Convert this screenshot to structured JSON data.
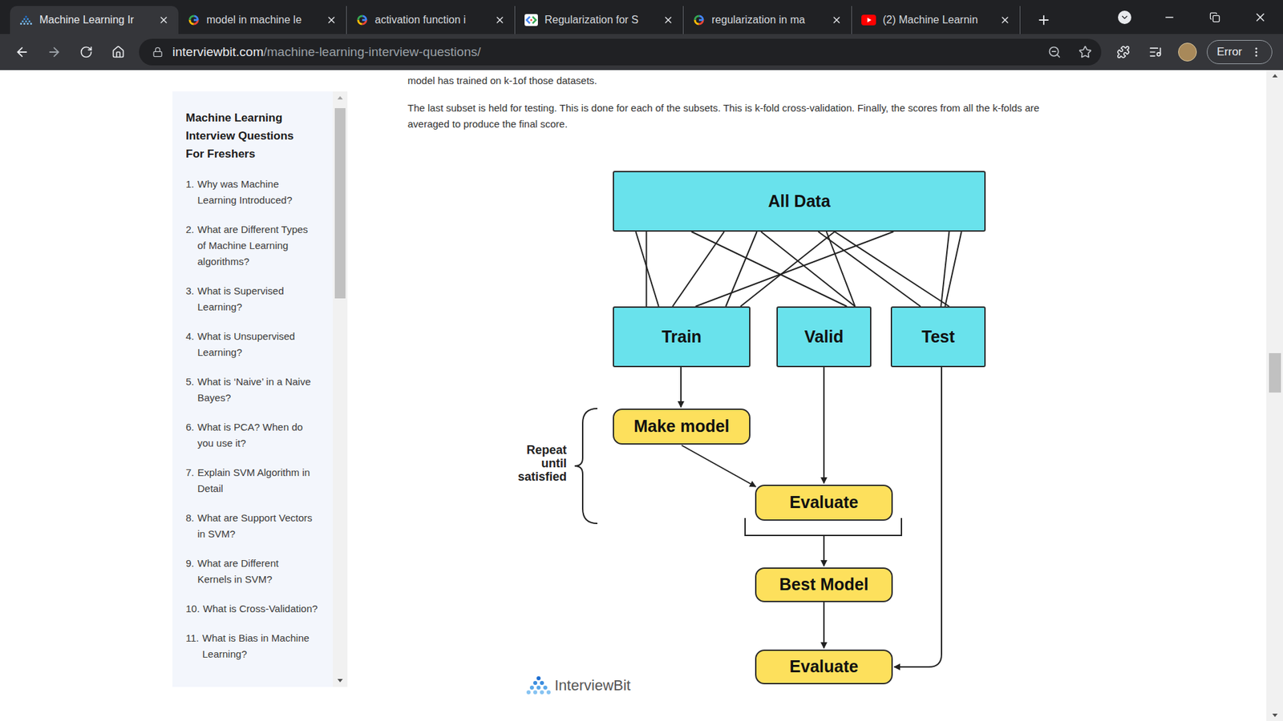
{
  "browser": {
    "tabs": [
      {
        "label": "Machine Learning Ir",
        "selected": true,
        "kind": "interviewbit"
      },
      {
        "label": "model in machine le",
        "selected": false,
        "kind": "google"
      },
      {
        "label": "activation function i",
        "selected": false,
        "kind": "google"
      },
      {
        "label": "Regularization for S",
        "selected": false,
        "kind": "developers"
      },
      {
        "label": "regularization in ma",
        "selected": false,
        "kind": "google"
      },
      {
        "label": "(2) Machine Learnin",
        "selected": false,
        "kind": "youtube"
      }
    ],
    "address": {
      "domain": "interviewbit.com",
      "path": "/machine-learning-interview-questions/"
    },
    "profile_status": "Error"
  },
  "sidebar": {
    "title": "Machine Learning Interview Questions For Freshers",
    "items": [
      {
        "number": "1.",
        "label": "Why was Machine Learning Introduced?"
      },
      {
        "number": "2.",
        "label": "What are Different Types of Machine Learning algorithms?"
      },
      {
        "number": "3.",
        "label": "What is Supervised Learning?"
      },
      {
        "number": "4.",
        "label": "What is Unsupervised Learning?"
      },
      {
        "number": "5.",
        "label": "What is ‘Naive’ in a Naive Bayes?"
      },
      {
        "number": "6.",
        "label": "What is PCA? When do you use it?"
      },
      {
        "number": "7.",
        "label": "Explain SVM Algorithm in Detail"
      },
      {
        "number": "8.",
        "label": "What are Support Vectors in SVM?"
      },
      {
        "number": "9.",
        "label": "What are Different Kernels in SVM?"
      },
      {
        "number": "10.",
        "label": "What is Cross-Validation?"
      },
      {
        "number": "11.",
        "label": "What is Bias in Machine Learning?"
      }
    ]
  },
  "article": {
    "paragraphs": [
      "model has trained on k-1of those datasets.",
      "The last subset is held for testing. This is done for each of the subsets. This is k-fold cross-validation. Finally, the scores from all the k-folds are averaged to produce the final score."
    ]
  },
  "diagram": {
    "nodes": [
      {
        "label": "All Data",
        "kind": "data"
      },
      {
        "label": "Train",
        "kind": "data"
      },
      {
        "label": "Valid",
        "kind": "data"
      },
      {
        "label": "Test",
        "kind": "data"
      },
      {
        "label": "Make model",
        "kind": "process"
      },
      {
        "label": "Evaluate",
        "kind": "process"
      },
      {
        "label": "Best Model",
        "kind": "process"
      },
      {
        "label": "Evaluate",
        "kind": "process"
      }
    ],
    "repeat_label": [
      "Repeat",
      "until",
      "satisfied"
    ],
    "logo": "InterviewBit"
  }
}
